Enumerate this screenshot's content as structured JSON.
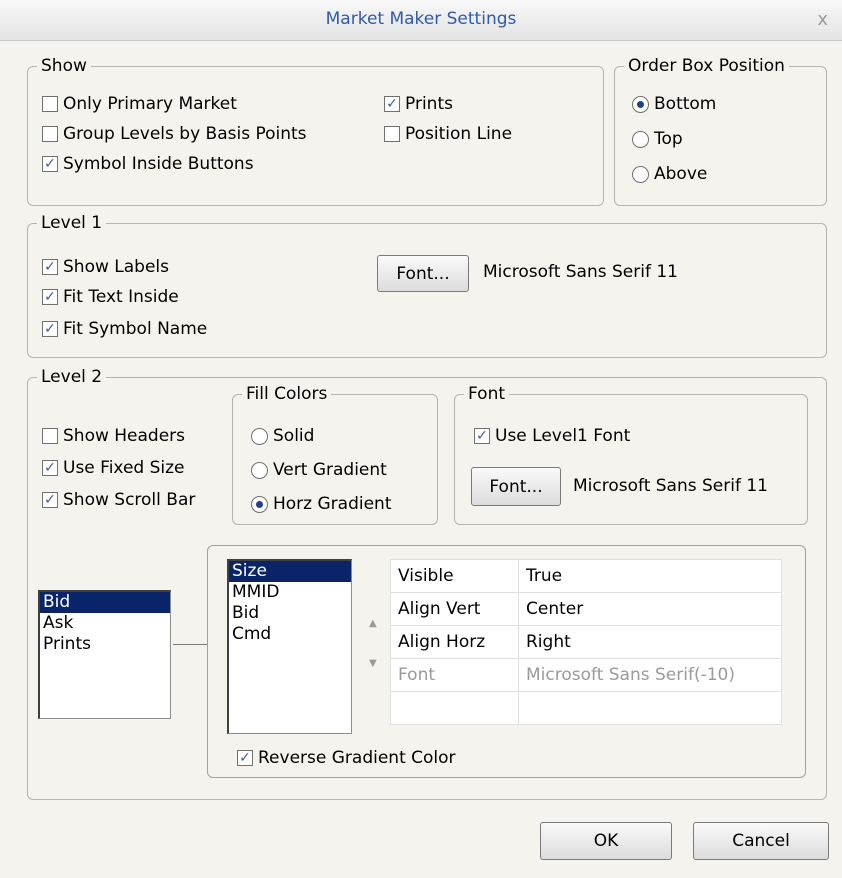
{
  "window": {
    "title": "Market Maker Settings",
    "close_glyph": "x"
  },
  "show_group": {
    "legend": "Show",
    "only_primary_market": {
      "label": "Only Primary Market",
      "checked": false
    },
    "group_levels": {
      "label": "Group Levels by Basis Points",
      "checked": false
    },
    "symbol_inside_buttons": {
      "label": "Symbol Inside Buttons",
      "checked": true
    },
    "prints": {
      "label": "Prints",
      "checked": true
    },
    "position_line": {
      "label": "Position Line",
      "checked": false
    }
  },
  "order_box_position": {
    "legend": "Order Box Position",
    "options": [
      "Bottom",
      "Top",
      "Above"
    ],
    "selected": "Bottom"
  },
  "level1": {
    "legend": "Level 1",
    "show_labels": {
      "label": "Show Labels",
      "checked": true
    },
    "fit_text_inside": {
      "label": "Fit Text Inside",
      "checked": true
    },
    "fit_symbol_name": {
      "label": "Fit Symbol Name",
      "checked": true
    },
    "font_button": "Font...",
    "font_value": "Microsoft Sans Serif 11"
  },
  "level2": {
    "legend": "Level 2",
    "show_headers": {
      "label": "Show Headers",
      "checked": false
    },
    "use_fixed_size": {
      "label": "Use Fixed Size",
      "checked": true
    },
    "show_scroll_bar": {
      "label": "Show Scroll Bar",
      "checked": true
    },
    "fill_colors": {
      "legend": "Fill Colors",
      "options": [
        "Solid",
        "Vert Gradient",
        "Horz Gradient"
      ],
      "selected": "Horz Gradient"
    },
    "font_group": {
      "legend": "Font",
      "use_level1_font": {
        "label": "Use Level1 Font",
        "checked": true
      },
      "font_button": "Font...",
      "font_value": "Microsoft Sans Serif 11"
    },
    "side_list": {
      "items": [
        "Bid",
        "Ask",
        "Prints"
      ],
      "selected": "Bid"
    },
    "column_list": {
      "items": [
        "Size",
        "MMID",
        "Bid",
        "Cmd"
      ],
      "selected": "Size"
    },
    "properties": [
      {
        "key": "Visible",
        "value": "True",
        "dimmed": false
      },
      {
        "key": "Align Vert",
        "value": "Center",
        "dimmed": false
      },
      {
        "key": "Align Horz",
        "value": "Right",
        "dimmed": false
      },
      {
        "key": "Font",
        "value": "Microsoft Sans Serif(-10)",
        "dimmed": true
      },
      {
        "key": "",
        "value": "",
        "dimmed": false
      }
    ],
    "reverse_gradient": {
      "label": "Reverse Gradient Color",
      "checked": true
    }
  },
  "buttons": {
    "ok": "OK",
    "cancel": "Cancel"
  }
}
